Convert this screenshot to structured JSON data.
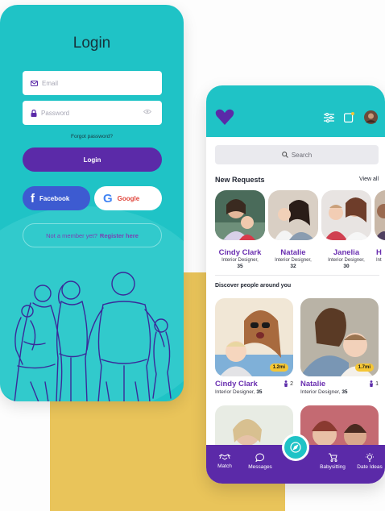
{
  "login": {
    "title": "Login",
    "email_placeholder": "Email",
    "password_placeholder": "Password",
    "forgot": "Forgot password?",
    "login_button": "Login",
    "facebook_button": "Facebook",
    "google_button": "Google",
    "member_prefix": "Not a member yet?",
    "member_link": "Register here"
  },
  "app": {
    "search_placeholder": "Search",
    "new_requests_title": "New Requests",
    "view_all": "View all",
    "requests": [
      {
        "name": "Cindy Clark",
        "role": "Interior Designer,",
        "age": "35"
      },
      {
        "name": "Natalie",
        "role": "Interior Designer,",
        "age": "32"
      },
      {
        "name": "Janelia",
        "role": "Interior Designer,",
        "age": "30"
      },
      {
        "name": "H",
        "role": "Int",
        "age": ""
      }
    ],
    "discover_title": "Discover people around you",
    "people": [
      {
        "name": "Cindy Clark",
        "role": "Interior Designer,",
        "age": "35",
        "distance": "1.2mi",
        "kids": "2"
      },
      {
        "name": "Natalie",
        "role": "Interior Designer,",
        "age": "35",
        "distance": "1.7mi",
        "kids": "1"
      }
    ],
    "tabs": {
      "match": "Match",
      "messages": "Messages",
      "babysitting": "Babysitting",
      "date_ideas": "Date Ideas"
    }
  },
  "colors": {
    "teal": "#1fc3c6",
    "purple": "#5b2aa8",
    "name_purple": "#6a2fb0",
    "mustard": "#e9c45a",
    "badge_yellow": "#f5c634"
  }
}
